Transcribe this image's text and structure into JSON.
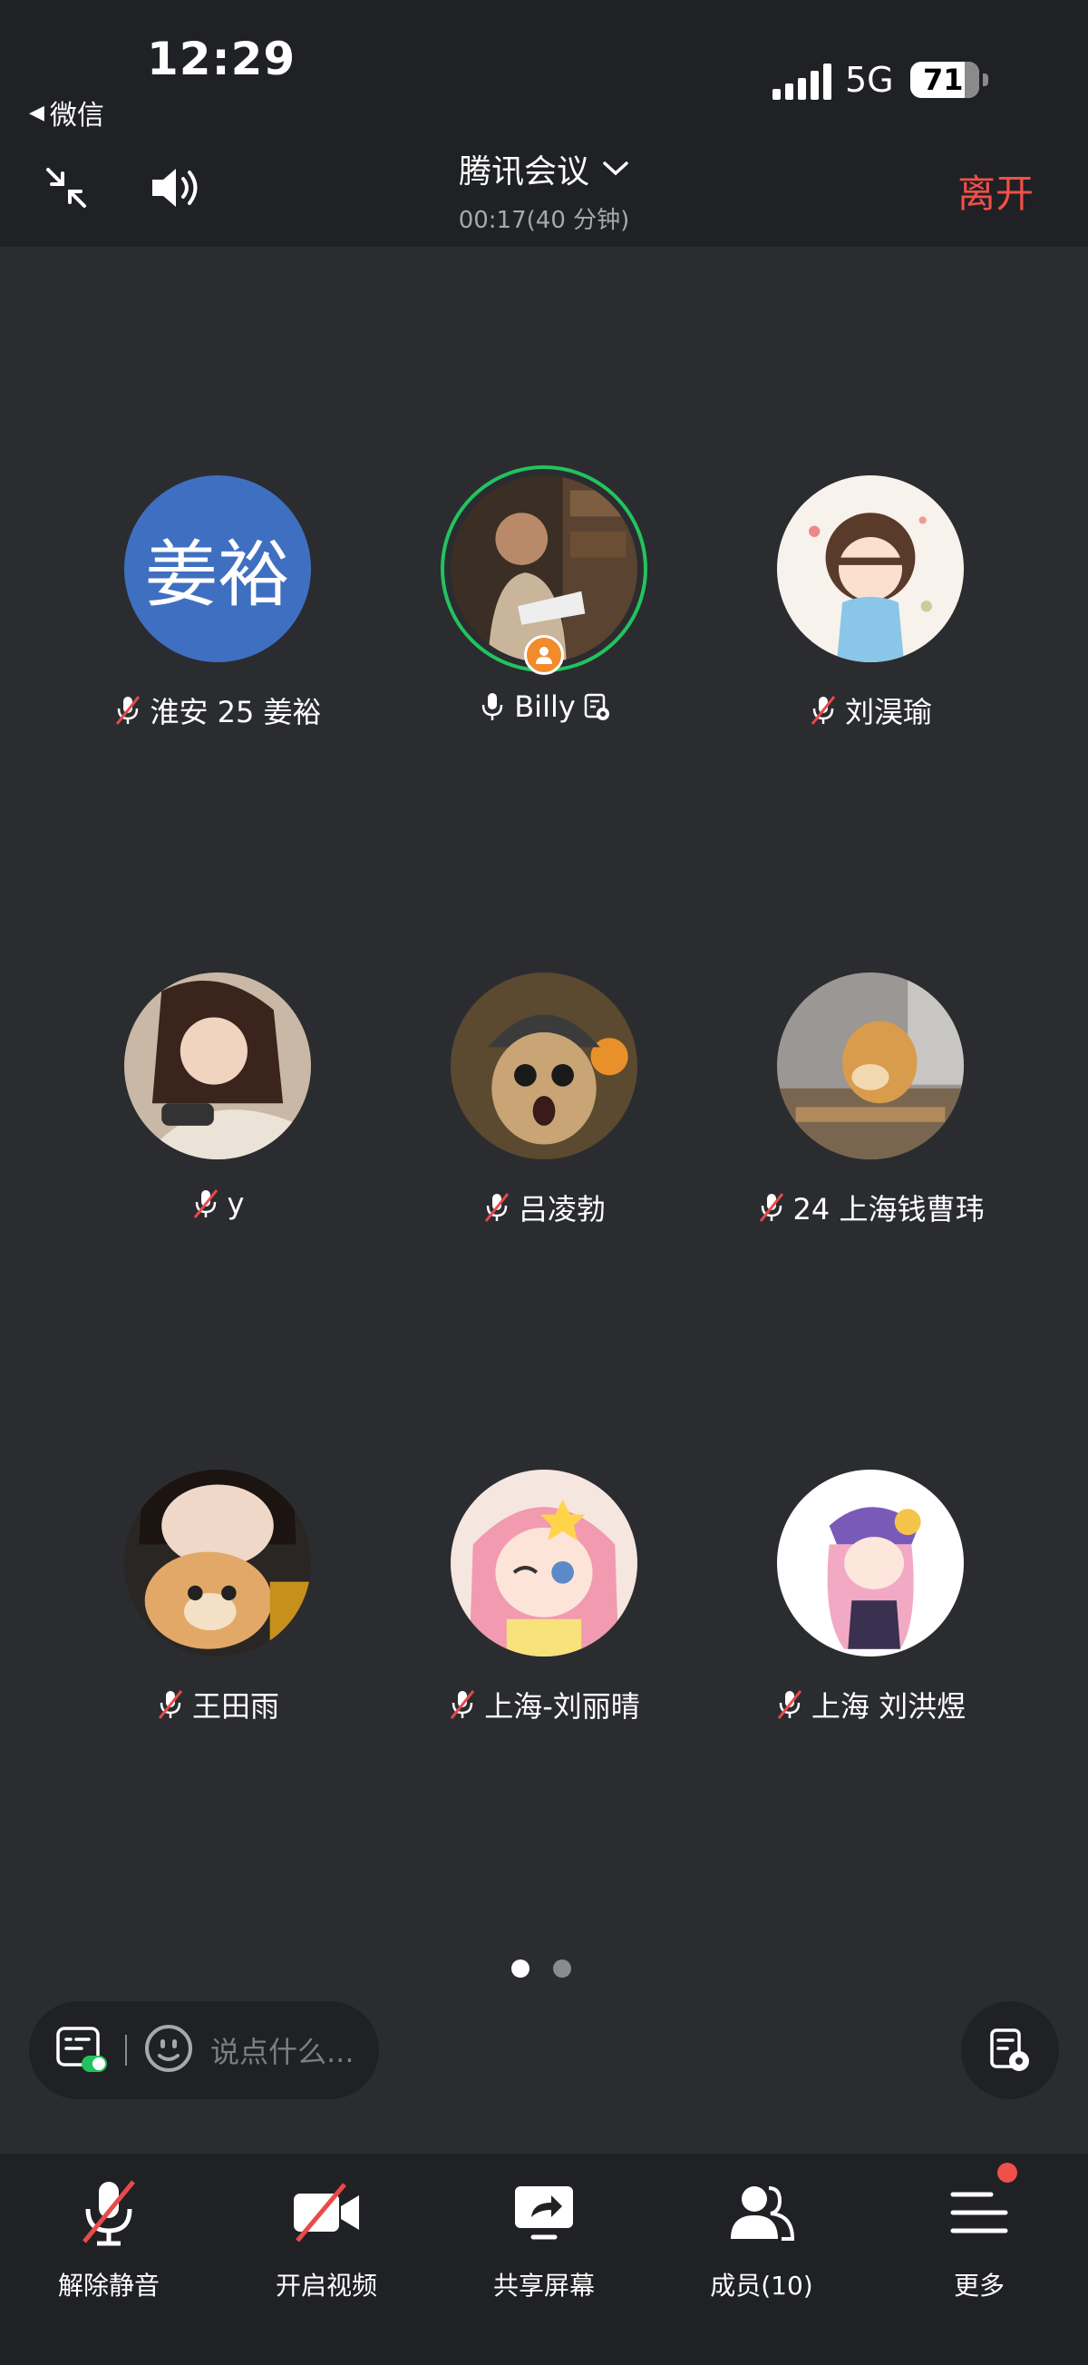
{
  "status_bar": {
    "time": "12:29",
    "back_app": "微信",
    "network": "5G",
    "battery": "71"
  },
  "header": {
    "title": "腾讯会议",
    "subtitle": "00:17(40 分钟)",
    "leave_label": "离开"
  },
  "participants": [
    {
      "name": "淮安 25 姜裕",
      "muted": true,
      "avatar_text": "姜裕"
    },
    {
      "name": "Billy",
      "muted": false,
      "host": true,
      "speaking": true
    },
    {
      "name": "刘淏瑜",
      "muted": true
    },
    {
      "name": "y",
      "muted": true
    },
    {
      "name": "吕凌勃",
      "muted": true
    },
    {
      "name": "24 上海钱曹玮",
      "muted": true
    },
    {
      "name": "王田雨",
      "muted": true
    },
    {
      "name": "上海-刘丽晴",
      "muted": true
    },
    {
      "name": "上海 刘洪煜",
      "muted": true
    }
  ],
  "pager": {
    "pages": 2,
    "current": 1
  },
  "chat": {
    "placeholder": "说点什么..."
  },
  "toolbar": {
    "unmute_label": "解除静音",
    "video_label": "开启视频",
    "share_label": "共享屏幕",
    "members_label": "成员(10)",
    "more_label": "更多"
  },
  "colors": {
    "background": "#2b2c30",
    "bar": "#202124",
    "leave": "#f0504a",
    "speaking_ring": "#22c35e",
    "letter_avatar": "#3f6fc0"
  }
}
